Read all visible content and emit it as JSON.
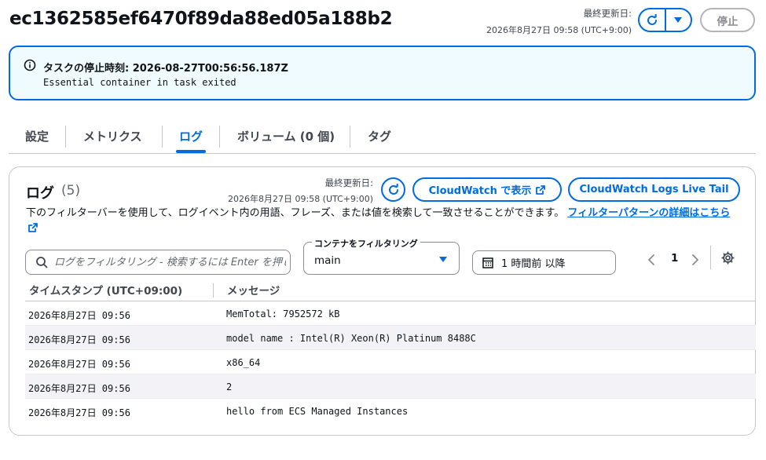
{
  "header": {
    "title": "ec1362585ef6470f89da88ed05a188b2",
    "updated_label": "最終更新日:",
    "updated_value": "2026年8月27日 09:58 (UTC+9:00)",
    "stop_label": "停止"
  },
  "alert": {
    "title": "タスクの停止時刻: 2026-08-27T00:56:56.187Z",
    "message": "Essential container in task exited"
  },
  "tabs": [
    {
      "label": "設定",
      "active": false
    },
    {
      "label": "メトリクス",
      "active": false
    },
    {
      "label": "ログ",
      "active": true
    },
    {
      "label": "ボリューム (0 個)",
      "active": false
    },
    {
      "label": "タグ",
      "active": false
    }
  ],
  "logs": {
    "title": "ログ",
    "count": "(5)",
    "updated_label": "最終更新日:",
    "updated_value": "2026年8月27日 09:58 (UTC+9:00)",
    "cloudwatch_button": "CloudWatch で表示",
    "live_tail_button": "CloudWatch Logs Live Tail",
    "description": "下のフィルターバーを使用して、ログイベント内の用語、フレーズ、または値を検索して一致させることができます。",
    "link_text": "フィルターパターンの詳細はこちら",
    "search_placeholder": "ログをフィルタリング - 検索するには Enter を押してください",
    "container_filter_label": "コンテナをフィルタリング",
    "container_filter_value": "main",
    "time_filter": "1 時間前 以降",
    "page": "1",
    "columns": [
      "タイムスタンプ (UTC+09:00)",
      "メッセージ"
    ],
    "rows": [
      {
        "timestamp": "2026年8月27日 09:56",
        "message": "MemTotal: 7952572 kB"
      },
      {
        "timestamp": "2026年8月27日 09:56",
        "message": "model name : Intel(R) Xeon(R) Platinum 8488C"
      },
      {
        "timestamp": "2026年8月27日 09:56",
        "message": "x86_64"
      },
      {
        "timestamp": "2026年8月27日 09:56",
        "message": "2"
      },
      {
        "timestamp": "2026年8月27日 09:56",
        "message": "hello from ECS Managed Instances"
      }
    ]
  },
  "colors": {
    "accent": "#006ce0",
    "alert_bg": "#f0fbff",
    "text": "#0f141a",
    "muted": "#424650",
    "border": "#c6c6cd"
  },
  "icons": [
    "refresh-icon",
    "caret-down-icon",
    "info-icon",
    "external-link-icon",
    "search-icon",
    "calendar-icon",
    "chevron-left-icon",
    "chevron-right-icon",
    "gear-icon"
  ]
}
